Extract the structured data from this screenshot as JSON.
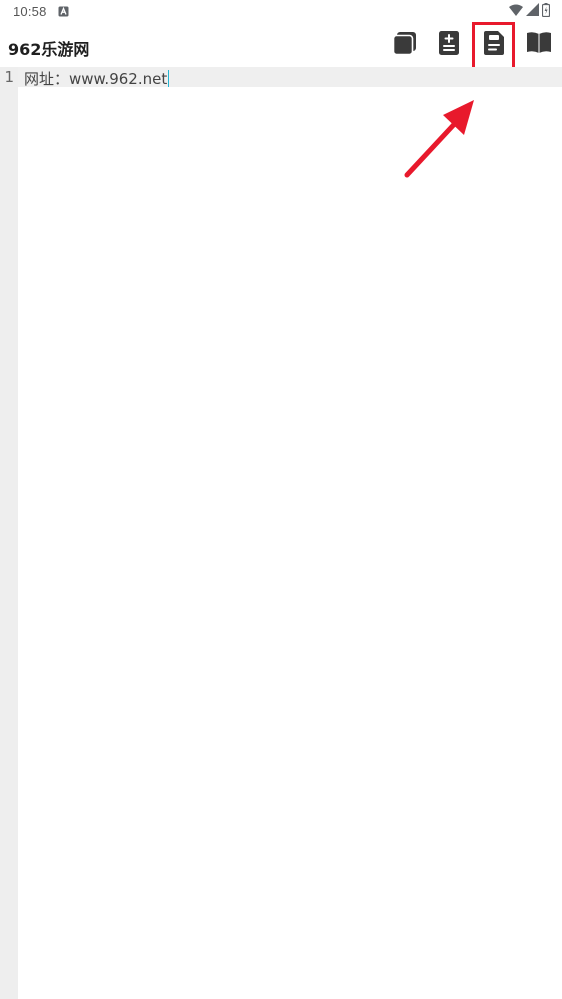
{
  "status_bar": {
    "time": "10:58",
    "icons": [
      "notification-a-icon",
      "wifi-icon",
      "signal-icon",
      "battery-icon"
    ]
  },
  "app_bar": {
    "title": "962乐游网",
    "actions": [
      {
        "name": "copy",
        "icon": "copy-icon"
      },
      {
        "name": "add-document",
        "icon": "add-document-icon"
      },
      {
        "name": "save",
        "icon": "save-document-icon"
      },
      {
        "name": "book",
        "icon": "book-icon"
      }
    ]
  },
  "editor": {
    "lines": [
      {
        "number": "1",
        "text": "网址：www.962.net"
      }
    ]
  },
  "annotation": {
    "color": "#e8192c",
    "target": "save"
  }
}
